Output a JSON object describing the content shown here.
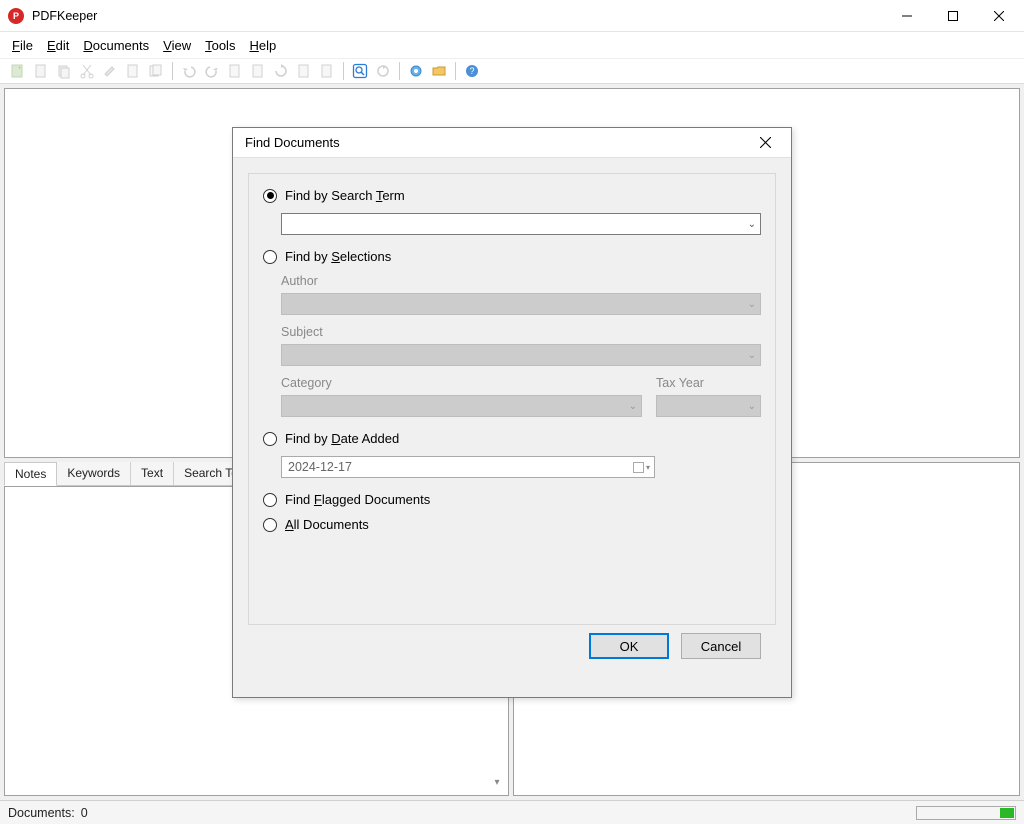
{
  "app": {
    "title": "PDFKeeper"
  },
  "menu": {
    "file": "File",
    "edit": "Edit",
    "documents": "Documents",
    "view": "View",
    "tools": "Tools",
    "help": "Help",
    "ul": {
      "file": "F",
      "edit": "E",
      "documents": "D",
      "view": "V",
      "tools": "T",
      "help": "H"
    }
  },
  "tabs": {
    "notes": "Notes",
    "keywords": "Keywords",
    "text": "Text",
    "search": "Search Term"
  },
  "status": {
    "documents_label": "Documents:",
    "documents_count": "0"
  },
  "dialog": {
    "title": "Find Documents",
    "opt_search": "Find by Search Term",
    "opt_search_ul": "T",
    "opt_selections": "Find by Selections",
    "opt_selections_ul": "S",
    "opt_date": "Find by Date Added",
    "opt_date_ul": "D",
    "opt_flagged": "Find Flagged Documents",
    "opt_flagged_ul": "F",
    "opt_all": "All Documents",
    "opt_all_ul": "A",
    "sel_author": "Author",
    "sel_subject": "Subject",
    "sel_category": "Category",
    "sel_taxyear": "Tax Year",
    "date_value": "2024-12-17",
    "ok": "OK",
    "cancel": "Cancel"
  },
  "toolbar_icons": [
    "new-search-icon",
    "document-icon",
    "copy-icon",
    "cut-icon",
    "edit-icon",
    "page-icon",
    "pages-icon",
    "undo-icon",
    "redo-icon",
    "doc-a-icon",
    "doc-b-icon",
    "refresh-icon",
    "doc-left-icon",
    "doc-right-icon",
    "find-icon",
    "reload-icon",
    "settings-icon",
    "folder-icon",
    "help-icon"
  ]
}
